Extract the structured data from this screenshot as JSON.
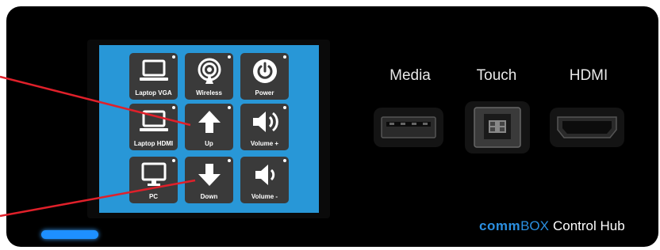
{
  "keys": [
    {
      "label": "Laptop VGA",
      "icon": "laptop-icon"
    },
    {
      "label": "Wireless",
      "icon": "wireless-icon"
    },
    {
      "label": "Power",
      "icon": "power-icon"
    },
    {
      "label": "Laptop HDMI",
      "icon": "laptop-icon"
    },
    {
      "label": "Up",
      "icon": "arrow-up-icon"
    },
    {
      "label": "Volume +",
      "icon": "volume-icon"
    },
    {
      "label": "PC",
      "icon": "monitor-icon"
    },
    {
      "label": "Down",
      "icon": "arrow-down-icon"
    },
    {
      "label": "Volume -",
      "icon": "volume-icon"
    }
  ],
  "ports": {
    "media": "Media",
    "touch": "Touch",
    "hdmi": "HDMI"
  },
  "brand": {
    "part1": "comm",
    "part2": "BOX",
    "part3": "Control Hub"
  },
  "colors": {
    "screen": "#2897d7",
    "key": "#3a3a3a",
    "led": "#1e90ff",
    "pointer": "#e0202a"
  }
}
